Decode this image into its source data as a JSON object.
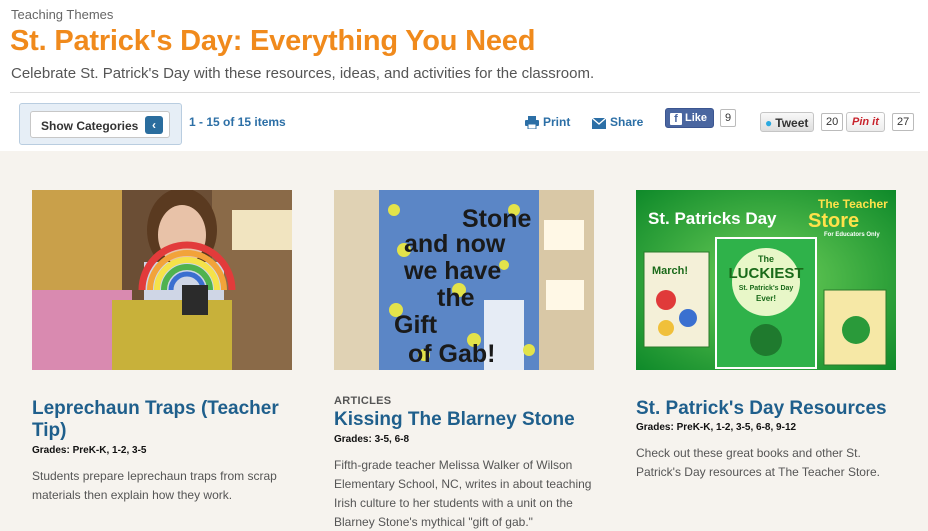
{
  "header": {
    "eyebrow": "Teaching Themes",
    "title": "St. Patrick's Day: Everything You Need",
    "subtitle": "Celebrate St. Patrick's Day with these resources, ideas, and activities for the classroom."
  },
  "toolbar": {
    "categories_label": "Show Categories",
    "categories_icon": "chevron-left-icon",
    "count": "1 - 15 of 15 items",
    "print_label": "Print",
    "share_label": "Share",
    "facebook": {
      "label": "Like",
      "count": "9"
    },
    "twitter": {
      "label": "Tweet",
      "count": "20"
    },
    "pinterest": {
      "label": "Pin it",
      "count": "27"
    }
  },
  "cards": [
    {
      "label": "",
      "title_line1": "Leprechaun Traps (Teacher",
      "title_line2": "Tip)",
      "grades": "Grades: PreK-K, 1-2, 3-5",
      "desc_line1": "Students prepare leprechaun traps from scrap",
      "desc_line2": "materials then explain how they work."
    },
    {
      "label": "ARTICLES",
      "title": "Kissing The Blarney Stone",
      "grades": "Grades: 3-5, 6-8",
      "desc_line1": "Fifth-grade teacher Melissa Walker of Wilson",
      "desc_line2": "Elementary School, NC, writes in about teaching",
      "desc_line3": "Irish culture to her students with a unit on the",
      "desc_line4": "Blarney Stone's mythical \"gift of gab.\"",
      "image_text": [
        "Stone",
        "and now",
        "we have",
        "the",
        "Gift",
        "of  Gab!"
      ]
    },
    {
      "label": "",
      "title": "St. Patrick's Day Resources",
      "grades": "Grades: PreK-K, 1-2, 3-5, 6-8, 9-12",
      "desc_line1": "Check out these great books and other St.",
      "desc_line2": "Patrick's Day resources at The Teacher Store.",
      "image_text": {
        "headline": "St. Patricks Day",
        "store_line1": "The Teacher",
        "store_line2": "Store",
        "store_tag": "For Educators Only",
        "book_center_line1": "The",
        "book_center_line2": "LUCKIEST",
        "book_center_line3": "St. Patrick's Day",
        "book_center_line4": "Ever!",
        "book_left": "March!"
      }
    }
  ],
  "colors": {
    "title": "#f08a1c",
    "link": "#2c6fa6",
    "card_title": "#1f5f8c",
    "content_bg": "#f6f3ee"
  }
}
